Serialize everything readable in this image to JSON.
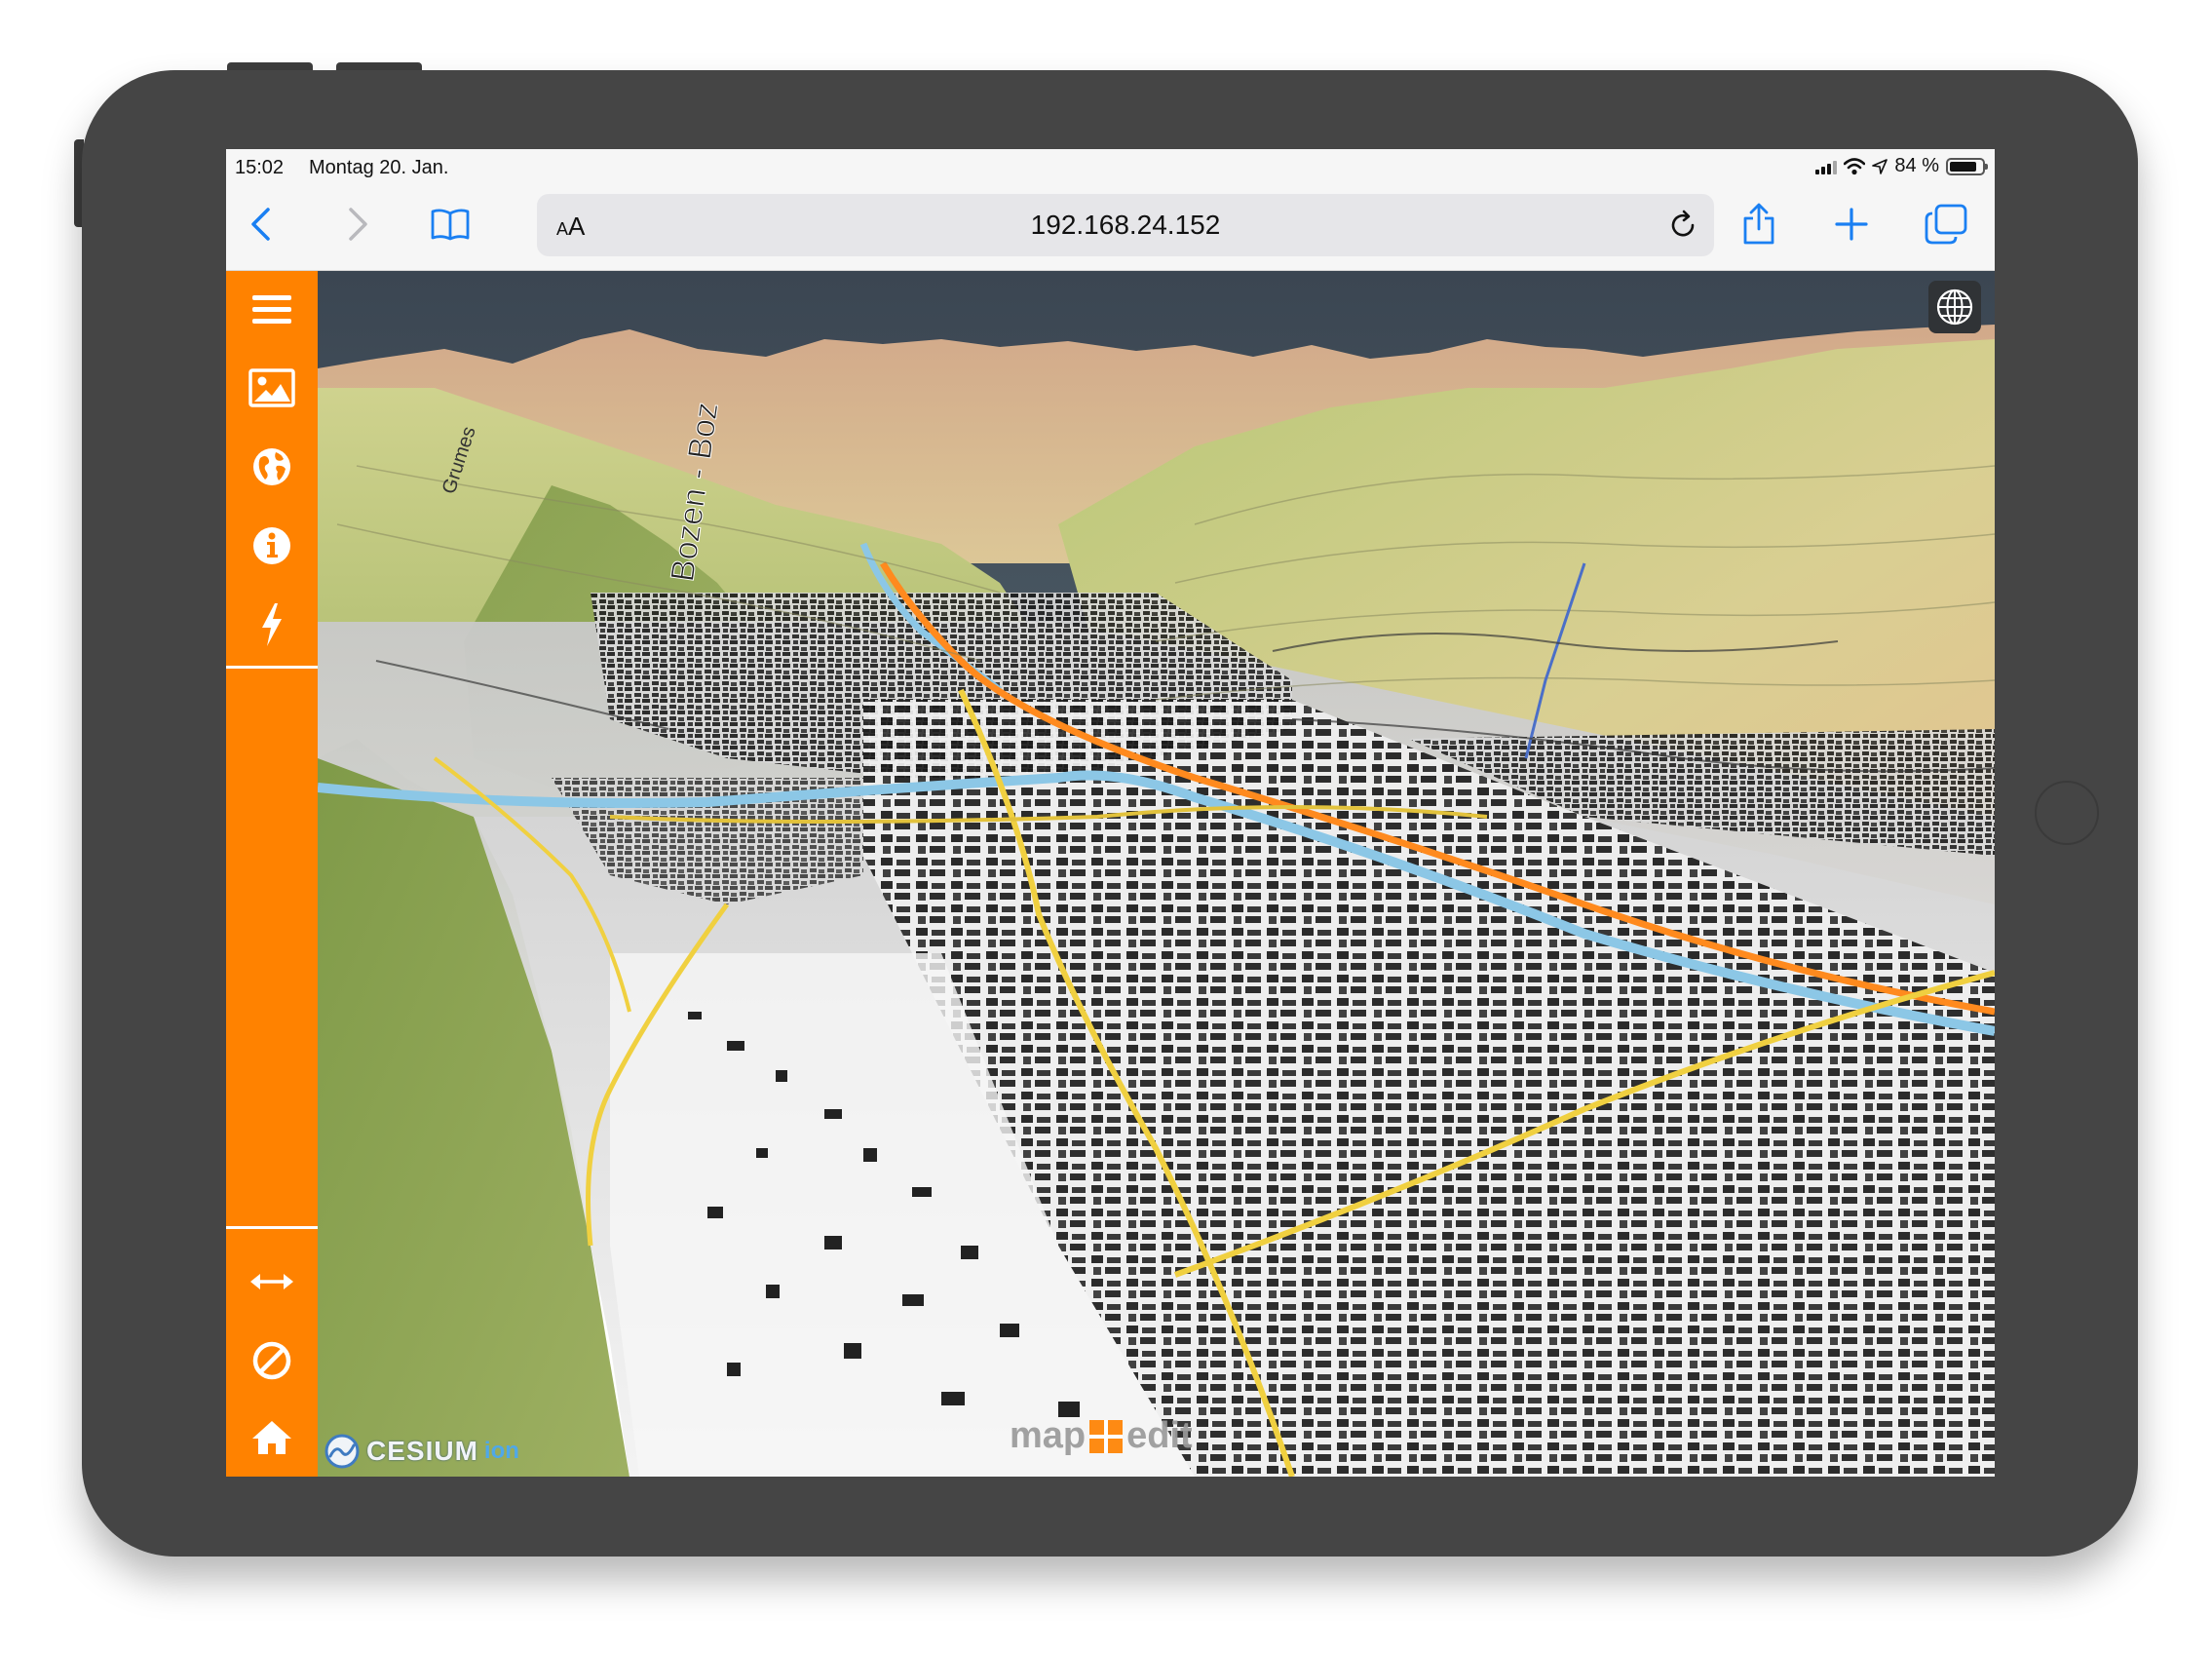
{
  "statusbar": {
    "time": "15:02",
    "date": "Montag 20. Jan.",
    "battery_text": "84 %",
    "battery_level": 0.84
  },
  "browser": {
    "url": "192.168.24.152",
    "text_size_label": "AA",
    "icons": [
      "back-chevron-icon",
      "forward-chevron-icon",
      "bookmarks-book-icon",
      "reload-icon",
      "share-icon",
      "plus-icon",
      "tabs-icon"
    ]
  },
  "sidebar": {
    "top_items": [
      {
        "icon": "menu-hamburger-icon"
      },
      {
        "icon": "image-layer-icon"
      },
      {
        "icon": "globe-icon"
      },
      {
        "icon": "info-icon"
      },
      {
        "icon": "lightning-icon"
      }
    ],
    "bottom_items": [
      {
        "icon": "horizontal-arrows-icon"
      },
      {
        "icon": "prohibited-circle-icon"
      },
      {
        "icon": "home-icon"
      }
    ],
    "color": "#ff8200"
  },
  "map": {
    "scene_mode_icon": "globe-wireframe-icon",
    "credits": {
      "cesium_main": "CESIUM",
      "cesium_sub": "ion",
      "brand_left": "map",
      "brand_right": "edit"
    },
    "labels": {
      "city": "Bozen - Boz",
      "road_left": "Grumes"
    },
    "sky_color": "#3d4a54"
  }
}
